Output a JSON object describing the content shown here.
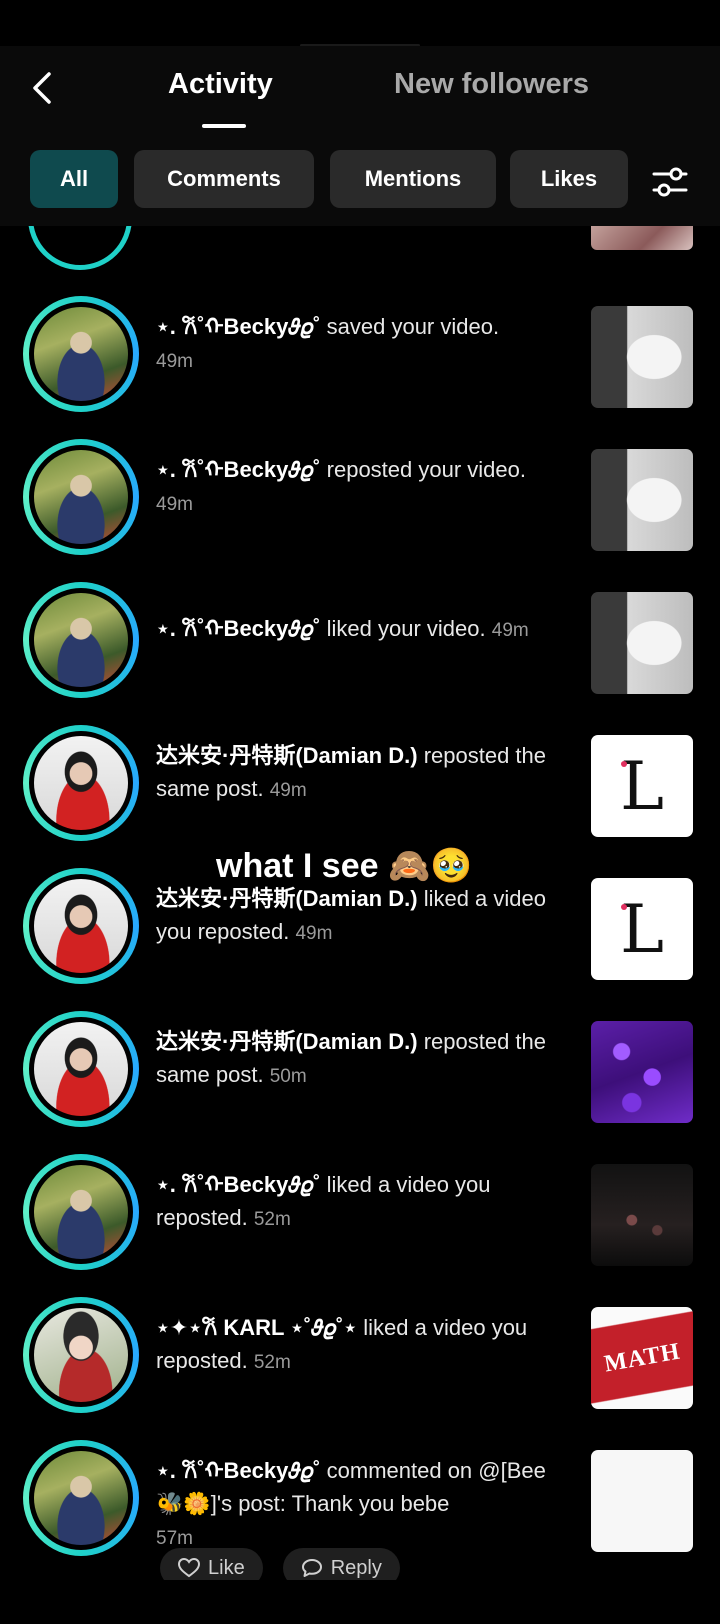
{
  "header": {
    "tabs": [
      {
        "label": "Activity",
        "active": true
      },
      {
        "label": "New followers",
        "active": false
      }
    ]
  },
  "filters": {
    "chips": [
      {
        "label": "All",
        "active": true
      },
      {
        "label": "Comments",
        "active": false
      },
      {
        "label": "Mentions",
        "active": false
      },
      {
        "label": "Likes",
        "active": false
      }
    ]
  },
  "notifications": [
    {
      "user": "⋆. 𐙚˚ᡣBecky𝜗𝜚˚",
      "action": "saved your video.",
      "time": "49m",
      "thumb": "gray"
    },
    {
      "user": "⋆. 𐙚˚ᡣBecky𝜗𝜚˚",
      "action": "reposted your video.",
      "time": "49m",
      "thumb": "gray"
    },
    {
      "user": "⋆. 𐙚˚ᡣBecky𝜗𝜚˚",
      "action": "liked your video.",
      "time": "49m",
      "thumb": "gray"
    },
    {
      "user": "达米安·丹特斯(Damian D.)",
      "action": "reposted the same post.",
      "time": "49m",
      "thumb": "L"
    },
    {
      "user": "达米安·丹特斯(Damian D.)",
      "action": "liked a video you reposted.",
      "time": "49m",
      "thumb": "L"
    },
    {
      "user": "达米安·丹特斯(Damian D.)",
      "action": "reposted the same post.",
      "time": "50m",
      "thumb": "purple"
    },
    {
      "user": "⋆. 𐙚˚ᡣBecky𝜗𝜚˚",
      "action": "liked a video you reposted.",
      "time": "52m",
      "thumb": "dark"
    },
    {
      "user": "⋆✦⋆𐙚 KARL ⋆˚𝜗𝜚˚⋆",
      "action": "liked a video you reposted.",
      "time": "52m",
      "thumb": "math"
    },
    {
      "user": "⋆. 𐙚˚ᡣBecky𝜗𝜚˚",
      "action": "commented on @[Bee🐝🌼]'s post: Thank you bebe",
      "time": "57m",
      "thumb": "white"
    }
  ],
  "thumb_texts": {
    "L": "L",
    "math": "MATH"
  },
  "overlay": {
    "caption": "what I see 🙈🥹"
  },
  "comment_actions": {
    "like_label": "Like",
    "reply_label": "Reply"
  },
  "colors": {
    "accent_chip": "#0f4a4e",
    "ring": "#1fd1c8"
  }
}
